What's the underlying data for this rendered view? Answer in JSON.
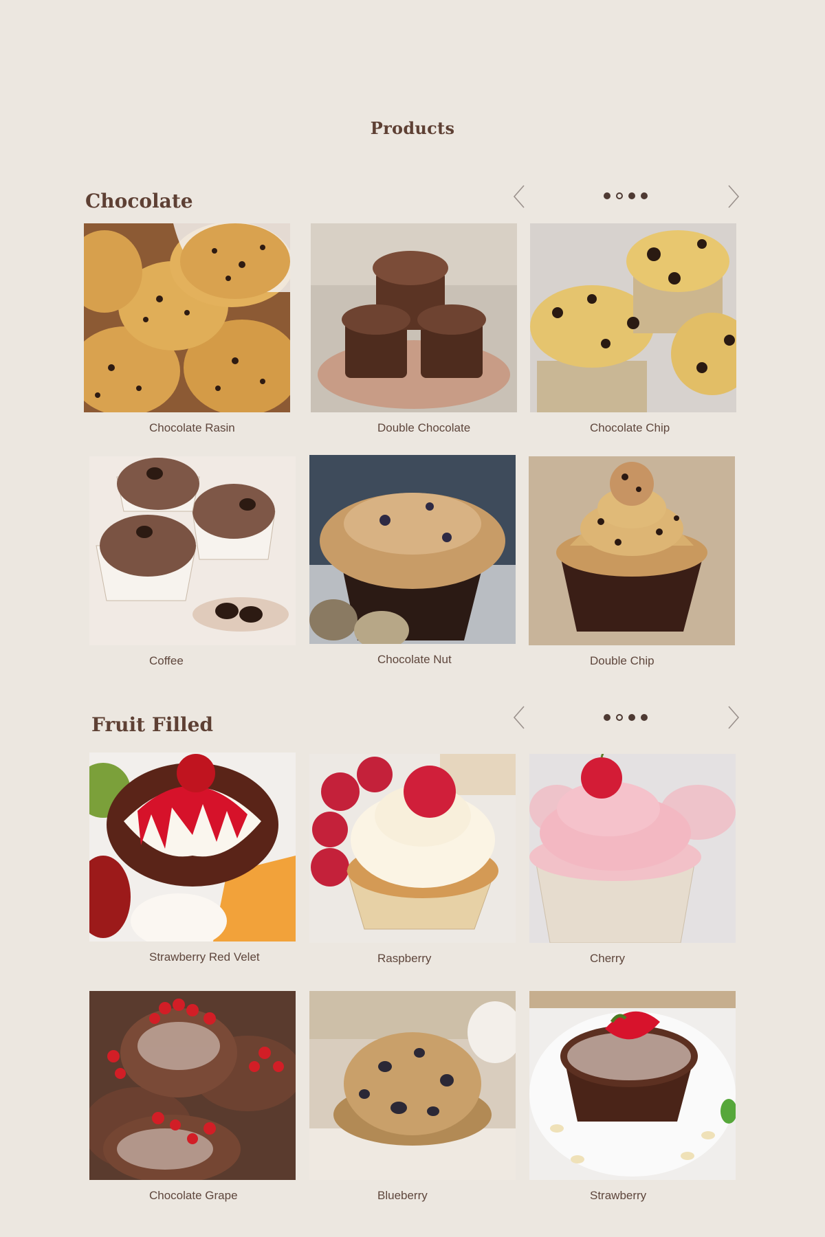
{
  "page": {
    "title": "Products"
  },
  "colors": {
    "background": "#ECE7E0",
    "title": "#5E4034",
    "text": "#5E463C"
  },
  "sections": [
    {
      "title": "Chocolate",
      "pager": {
        "total": 4,
        "active_index": 1
      },
      "products": [
        {
          "name": "Chocolate Rasin"
        },
        {
          "name": "Double Chocolate"
        },
        {
          "name": "Chocolate Chip"
        },
        {
          "name": "Coffee"
        },
        {
          "name": "Chocolate Nut"
        },
        {
          "name": "Double Chip"
        }
      ]
    },
    {
      "title": "Fruit Filled",
      "pager": {
        "total": 4,
        "active_index": 1
      },
      "products": [
        {
          "name": "Strawberry Red Velet"
        },
        {
          "name": "Raspberry"
        },
        {
          "name": "Cherry"
        },
        {
          "name": "Chocolate Grape"
        },
        {
          "name": "Blueberry"
        },
        {
          "name": "Strawberry"
        }
      ]
    }
  ],
  "icons": {
    "prev": "chevron-left-icon",
    "next": "chevron-right-icon"
  }
}
